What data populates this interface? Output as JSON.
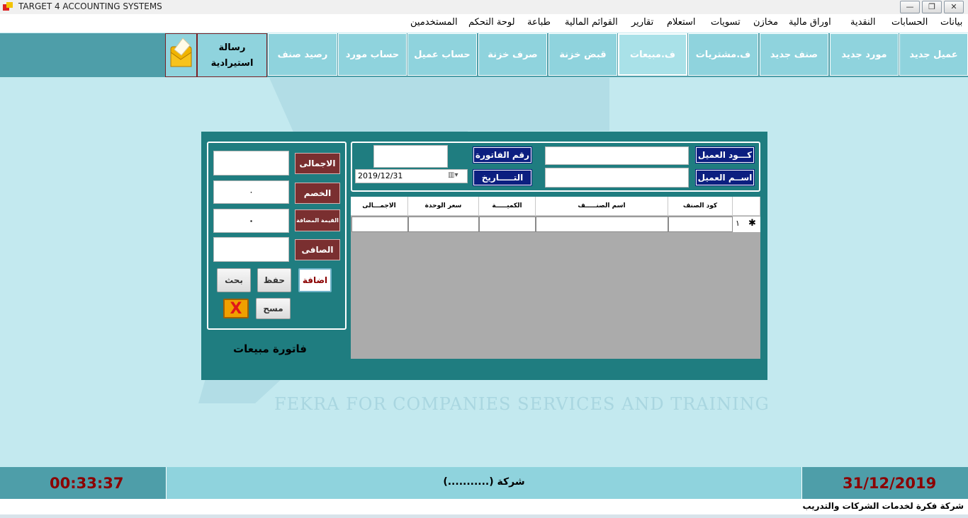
{
  "window": {
    "title": "TARGET 4 ACCOUNTING SYSTEMS"
  },
  "menu": [
    "بيانات",
    "الحسابات",
    "النقدية",
    "اوراق مالية",
    "مخازن",
    "تسويات",
    "استعلام",
    "تقارير",
    "القوائم المالية",
    "طباعة",
    "لوحة التحكم",
    "المستخدمين"
  ],
  "toolbar": {
    "buttons": [
      "عميل جديد",
      "مورد جديد",
      "صنف جديد",
      "ف.مشتريات",
      "ف.مبيعات",
      "قبض خزنة",
      "صرف خزنة",
      "حساب عميل",
      "حساب مورد",
      "رصيد صنف"
    ],
    "message_line1": "رسالة",
    "message_line2": "استيرادية"
  },
  "watermark": "FEKRA FOR COMPANIES SERVICES AND TRAINING",
  "invoice": {
    "customer_code_label": "كـــود العميل",
    "customer_name_label": "اســم العميل",
    "invoice_no_label": "رقم الفاتورة",
    "date_label": "التـــــاريخ",
    "date_value": "2019/12/31",
    "title": "فاتورة مبيعات",
    "columns": [
      "كود الصنف",
      "اسم الصنـــــف",
      "الكميـــــة",
      "سعر الوحدة",
      "الاجمـــالى"
    ],
    "row_number": "١",
    "total_label": "الاجمالى",
    "discount_label": "الخصم",
    "discount_value": "٠",
    "vat_label": "القيمة المضافة",
    "vat_value": "٠",
    "net_label": "الصافى",
    "add_label": "اضافة",
    "save_label": "حفظ",
    "search_label": "بحث",
    "clear_label": "مسح",
    "close_label": "X"
  },
  "status": {
    "time": "00:33:37",
    "company": "(...........) شركة",
    "date": "31/12/2019"
  },
  "footer": "شركة فكرة لخدمات الشركات والتدريب",
  "colors": {
    "toolbar": "#4e9ea9",
    "button": "#8fd3dd",
    "panel": "#1f7d80",
    "navy": "#0c1f80",
    "maroon": "#7a2f30",
    "status_text": "#8b0000"
  }
}
